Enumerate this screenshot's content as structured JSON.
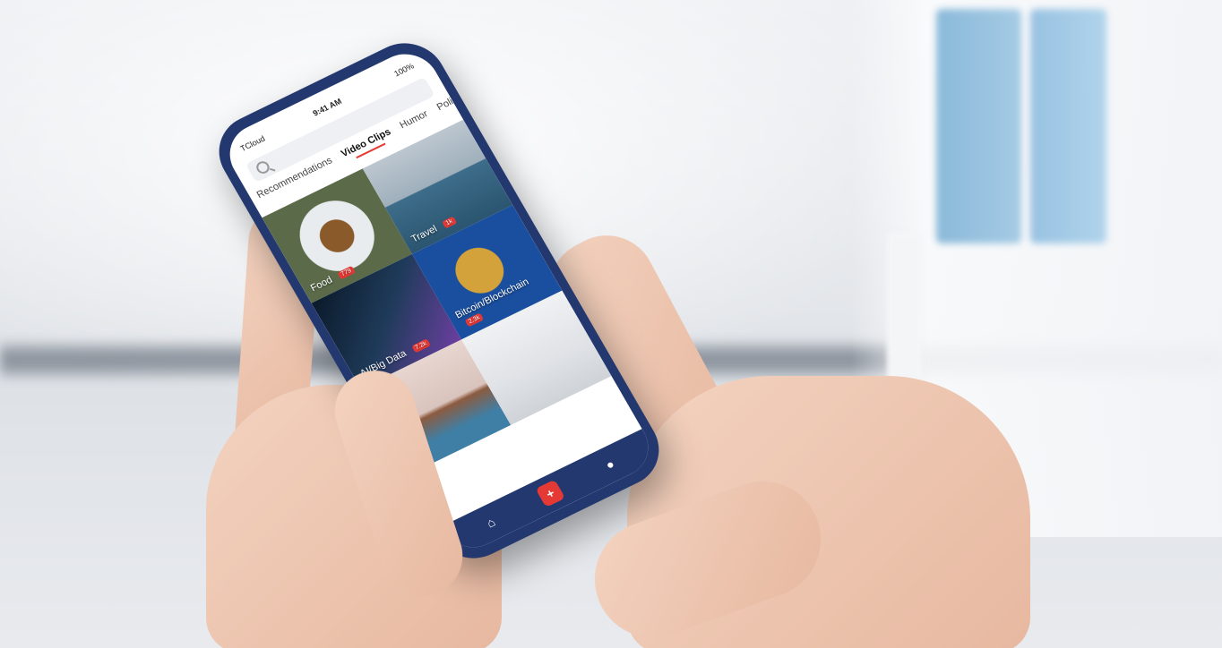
{
  "status": {
    "carrier": "TCloud",
    "time": "9:41 AM",
    "battery": "100%"
  },
  "search": {
    "placeholder": ""
  },
  "tabs": [
    {
      "label": "Recommendations"
    },
    {
      "label": "Video Clips",
      "active": true
    },
    {
      "label": "Humor"
    },
    {
      "label": "Politics"
    }
  ],
  "tiles": [
    {
      "label": "Food",
      "badge": "779"
    },
    {
      "label": "Travel",
      "badge": "1k"
    },
    {
      "label": "AI/Big Data",
      "badge": "7.2k"
    },
    {
      "label": "Bitcoin/Blockchain",
      "badge": "2.3k"
    },
    {
      "label": "",
      "badge": ""
    },
    {
      "label": "",
      "badge": ""
    }
  ],
  "nav": {
    "home_icon": "⌂",
    "add_icon": "+",
    "profile_icon": "●"
  },
  "colors": {
    "phone_body": "#23386f",
    "accent": "#e53935"
  }
}
